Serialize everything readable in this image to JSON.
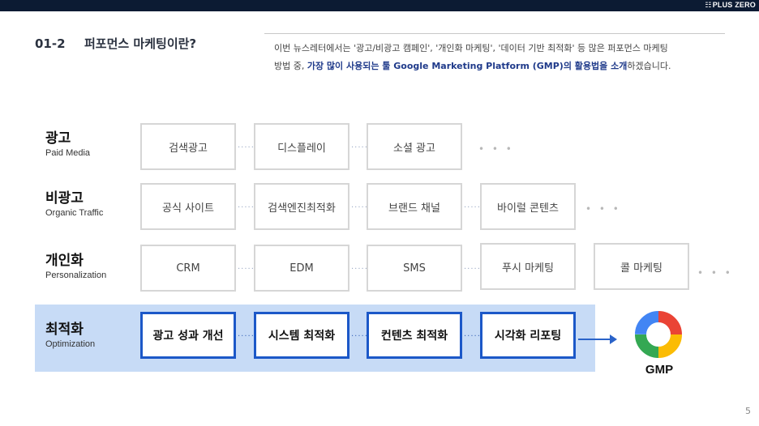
{
  "brand": {
    "logo": "PLUS ZERO",
    "logo_mark": "☷"
  },
  "header": {
    "section_number": "01-2",
    "title": "퍼포먼스 마케팅이란?",
    "desc_line1": "이번 뉴스레터에서는 '광고/비광고 캠페인', '개인화 마케팅', '데이터 기반 최적화' 등 많은 퍼포먼스 마케팅",
    "desc_line2_pre": "방법 중, ",
    "desc_line2_hl": "가장 많이 사용되는 툴 Google Marketing Platform (GMP)의 활용법을 소개",
    "desc_line2_post": "하겠습니다."
  },
  "rows": {
    "paid": {
      "title": "광고",
      "subtitle": "Paid Media",
      "items": [
        "검색광고",
        "디스플레이",
        "소셜 광고"
      ],
      "more": "• • •"
    },
    "organic": {
      "title": "비광고",
      "subtitle": "Organic Traffic",
      "items": [
        "공식 사이트",
        "검색엔진최적화",
        "브랜드 채널",
        "바이럴 콘텐츠"
      ],
      "more": "• • •"
    },
    "personal": {
      "title": "개인화",
      "subtitle": "Personalization",
      "items": [
        "CRM",
        "EDM",
        "SMS",
        "푸시 마케팅",
        "콜 마케팅"
      ],
      "more": "• • •"
    },
    "optimization": {
      "title": "최적화",
      "subtitle": "Optimization",
      "items": [
        "광고 성과 개선",
        "시스템 최적화",
        "컨텐츠 최적화",
        "시각화 리포팅"
      ]
    }
  },
  "connector": "·····",
  "gmp": {
    "label": "GMP",
    "icon": "gmp-logo-icon"
  },
  "footer": {
    "page_number": "5"
  },
  "colors": {
    "accent": "#1c58c8",
    "band": "#c7dbf6",
    "topbar": "#0c1b33"
  }
}
